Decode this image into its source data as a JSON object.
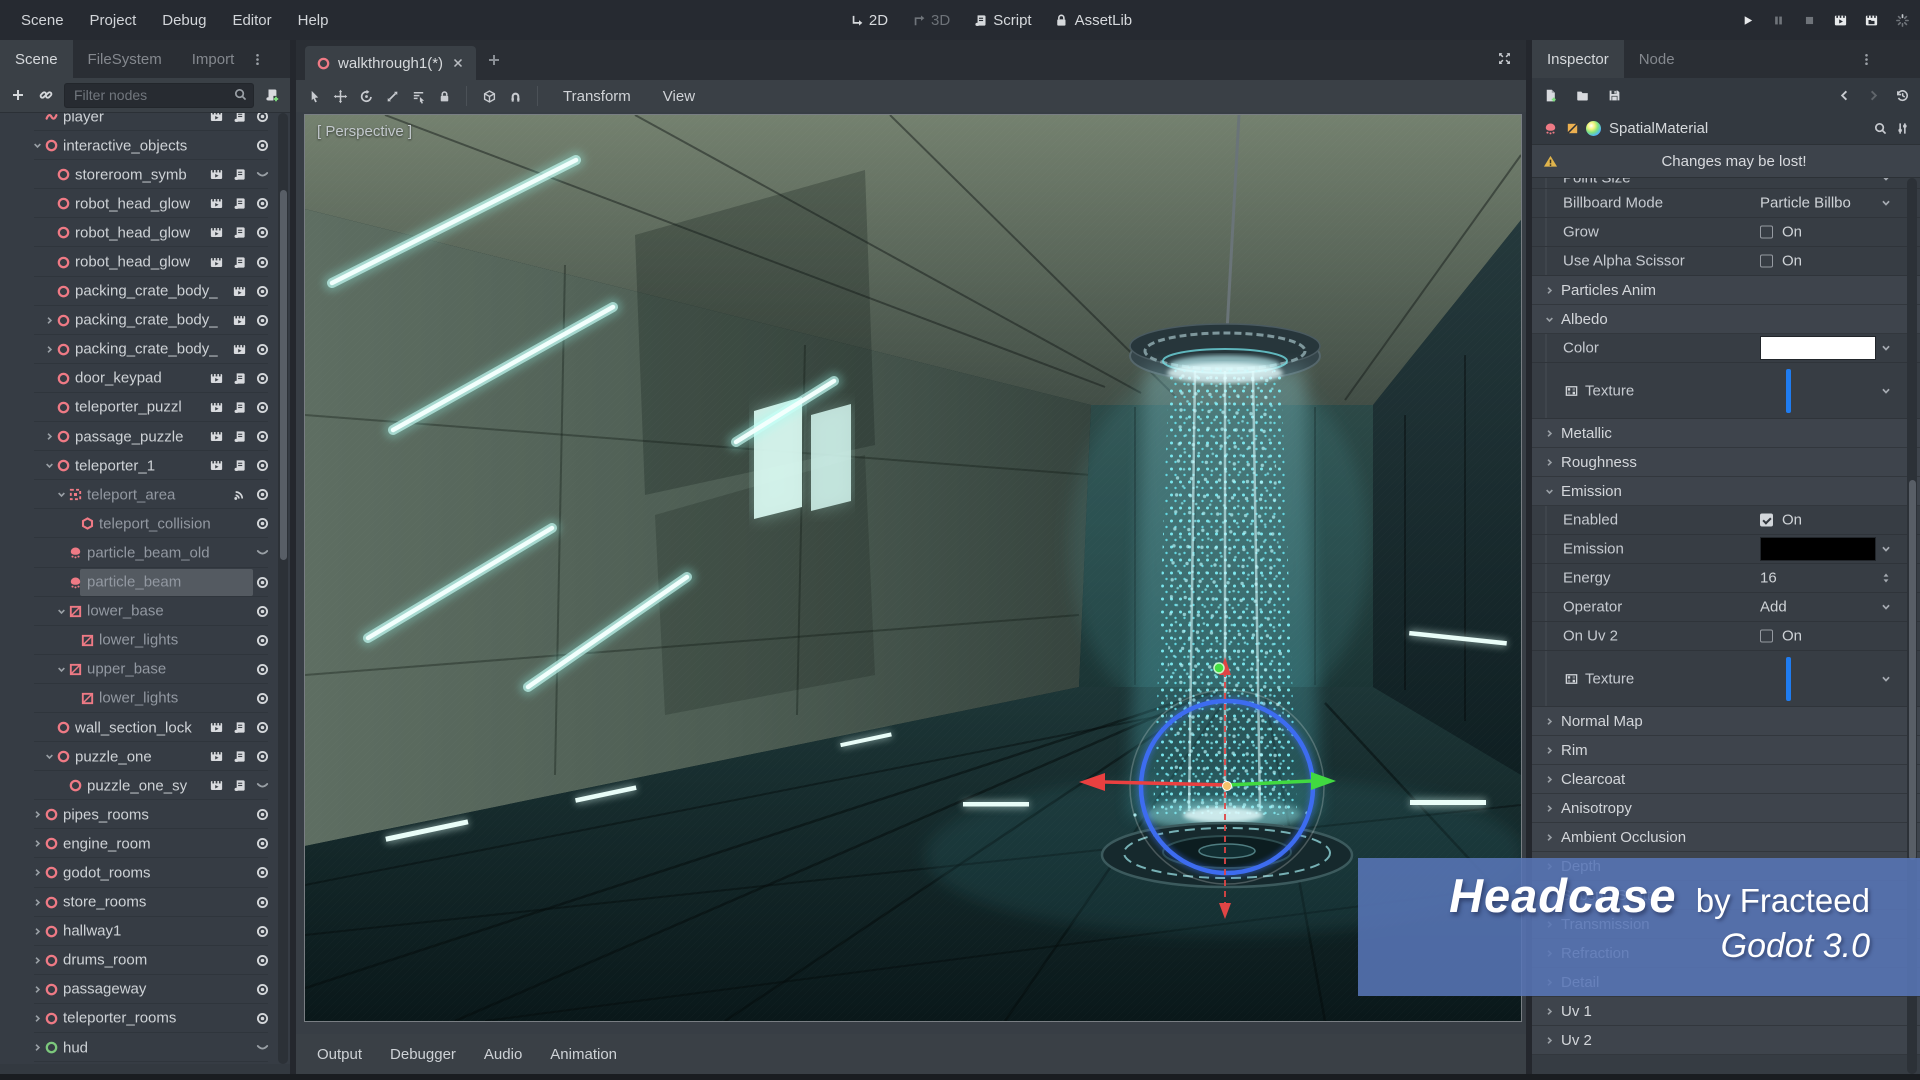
{
  "menubar": {
    "items": [
      "Scene",
      "Project",
      "Debug",
      "Editor",
      "Help"
    ],
    "center": [
      {
        "label": "2D",
        "icon": "nav2d",
        "bright": true
      },
      {
        "label": "3D",
        "icon": "nav3d",
        "bright": false
      },
      {
        "label": "Script",
        "icon": "scroll",
        "bright": true
      },
      {
        "label": "AssetLib",
        "icon": "assetlib",
        "bright": true
      }
    ],
    "playback": [
      {
        "icon": "play",
        "bright": true
      },
      {
        "icon": "pause",
        "bright": false
      },
      {
        "icon": "stop",
        "bright": false
      },
      {
        "icon": "play-scene",
        "bright": true
      },
      {
        "icon": "play-custom",
        "bright": true
      },
      {
        "icon": "spinner",
        "bright": false
      }
    ]
  },
  "left_dock": {
    "tabs": [
      {
        "label": "Scene",
        "active": true
      },
      {
        "label": "FileSystem",
        "active": false
      },
      {
        "label": "Import",
        "active": false
      }
    ],
    "filter_placeholder": "Filter nodes",
    "tree": [
      {
        "label": "player",
        "level": 1,
        "icon": "player",
        "arrow": "",
        "buttons": [
          "clapper",
          "script",
          "eye"
        ],
        "dim": false,
        "selected": false
      },
      {
        "label": "interactive_objects",
        "level": 1,
        "icon": "ring",
        "arrow": "down",
        "buttons": [
          "eye"
        ],
        "dim": false,
        "selected": false
      },
      {
        "label": "storeroom_symb",
        "level": 2,
        "icon": "ring",
        "arrow": "",
        "buttons": [
          "clapper",
          "script",
          "eye-closed"
        ],
        "dim": false,
        "selected": false
      },
      {
        "label": "robot_head_glow",
        "level": 2,
        "icon": "ring",
        "arrow": "",
        "buttons": [
          "clapper",
          "script",
          "eye"
        ],
        "dim": false,
        "selected": false
      },
      {
        "label": "robot_head_glow",
        "level": 2,
        "icon": "ring",
        "arrow": "",
        "buttons": [
          "clapper",
          "script",
          "eye"
        ],
        "dim": false,
        "selected": false
      },
      {
        "label": "robot_head_glow",
        "level": 2,
        "icon": "ring",
        "arrow": "",
        "buttons": [
          "clapper",
          "script",
          "eye"
        ],
        "dim": false,
        "selected": false
      },
      {
        "label": "packing_crate_body_",
        "level": 2,
        "icon": "ring",
        "arrow": "",
        "buttons": [
          "clapper",
          "eye"
        ],
        "dim": false,
        "selected": false
      },
      {
        "label": "packing_crate_body_",
        "level": 2,
        "icon": "ring",
        "arrow": "right",
        "buttons": [
          "clapper",
          "eye"
        ],
        "dim": false,
        "selected": false
      },
      {
        "label": "packing_crate_body_",
        "level": 2,
        "icon": "ring",
        "arrow": "right",
        "buttons": [
          "clapper",
          "eye"
        ],
        "dim": false,
        "selected": false
      },
      {
        "label": "door_keypad",
        "level": 2,
        "icon": "ring",
        "arrow": "",
        "buttons": [
          "clapper",
          "script",
          "eye"
        ],
        "dim": false,
        "selected": false
      },
      {
        "label": "teleporter_puzzl",
        "level": 2,
        "icon": "ring",
        "arrow": "",
        "buttons": [
          "clapper",
          "script",
          "eye"
        ],
        "dim": false,
        "selected": false
      },
      {
        "label": "passage_puzzle",
        "level": 2,
        "icon": "ring",
        "arrow": "right",
        "buttons": [
          "clapper",
          "script",
          "eye"
        ],
        "dim": false,
        "selected": false
      },
      {
        "label": "teleporter_1",
        "level": 2,
        "icon": "ring",
        "arrow": "down",
        "buttons": [
          "clapper",
          "script",
          "eye"
        ],
        "dim": false,
        "selected": false
      },
      {
        "label": "teleport_area",
        "level": 3,
        "icon": "area",
        "arrow": "down",
        "buttons": [
          "signal",
          "eye"
        ],
        "dim": true,
        "selected": false
      },
      {
        "label": "teleport_collision",
        "level": 4,
        "icon": "collision",
        "arrow": "",
        "buttons": [
          "eye"
        ],
        "dim": true,
        "selected": false
      },
      {
        "label": "particle_beam_old",
        "level": 3,
        "icon": "particles",
        "arrow": "",
        "buttons": [
          "eye-closed"
        ],
        "dim": true,
        "selected": false
      },
      {
        "label": "particle_beam",
        "level": 3,
        "icon": "particles",
        "arrow": "",
        "buttons": [
          "eye"
        ],
        "dim": true,
        "selected": true
      },
      {
        "label": "lower_base",
        "level": 3,
        "icon": "mesh",
        "arrow": "down",
        "buttons": [
          "eye"
        ],
        "dim": true,
        "selected": false
      },
      {
        "label": "lower_lights",
        "level": 4,
        "icon": "mesh",
        "arrow": "",
        "buttons": [
          "eye"
        ],
        "dim": true,
        "selected": false
      },
      {
        "label": "upper_base",
        "level": 3,
        "icon": "mesh",
        "arrow": "down",
        "buttons": [
          "eye"
        ],
        "dim": true,
        "selected": false
      },
      {
        "label": "lower_lights",
        "level": 4,
        "icon": "mesh",
        "arrow": "",
        "buttons": [
          "eye"
        ],
        "dim": true,
        "selected": false
      },
      {
        "label": "wall_section_lock",
        "level": 2,
        "icon": "ring",
        "arrow": "",
        "buttons": [
          "clapper",
          "script",
          "eye"
        ],
        "dim": false,
        "selected": false
      },
      {
        "label": "puzzle_one",
        "level": 2,
        "icon": "ring",
        "arrow": "down",
        "buttons": [
          "clapper",
          "script",
          "eye"
        ],
        "dim": false,
        "selected": false
      },
      {
        "label": "puzzle_one_sy",
        "level": 3,
        "icon": "ring",
        "arrow": "",
        "buttons": [
          "clapper",
          "script",
          "eye-closed"
        ],
        "dim": false,
        "selected": false
      },
      {
        "label": "pipes_rooms",
        "level": 1,
        "icon": "ring",
        "arrow": "right",
        "buttons": [
          "eye"
        ],
        "dim": false,
        "selected": false
      },
      {
        "label": "engine_room",
        "level": 1,
        "icon": "ring",
        "arrow": "right",
        "buttons": [
          "eye"
        ],
        "dim": false,
        "selected": false
      },
      {
        "label": "godot_rooms",
        "level": 1,
        "icon": "ring",
        "arrow": "right",
        "buttons": [
          "eye"
        ],
        "dim": false,
        "selected": false
      },
      {
        "label": "store_rooms",
        "level": 1,
        "icon": "ring",
        "arrow": "right",
        "buttons": [
          "eye"
        ],
        "dim": false,
        "selected": false
      },
      {
        "label": "hallway1",
        "level": 1,
        "icon": "ring",
        "arrow": "right",
        "buttons": [
          "eye"
        ],
        "dim": false,
        "selected": false
      },
      {
        "label": "drums_room",
        "level": 1,
        "icon": "ring",
        "arrow": "right",
        "buttons": [
          "eye"
        ],
        "dim": false,
        "selected": false
      },
      {
        "label": "passageway",
        "level": 1,
        "icon": "ring",
        "arrow": "right",
        "buttons": [
          "eye"
        ],
        "dim": false,
        "selected": false
      },
      {
        "label": "teleporter_rooms",
        "level": 1,
        "icon": "ring",
        "arrow": "right",
        "buttons": [
          "eye"
        ],
        "dim": false,
        "selected": false
      },
      {
        "label": "hud",
        "level": 1,
        "icon": "ring-green",
        "arrow": "right",
        "buttons": [
          "eye-closed"
        ],
        "dim": false,
        "selected": false
      }
    ]
  },
  "scene_tabs": {
    "tabs": [
      {
        "label": "walkthrough1(*)"
      }
    ],
    "viewport_menus": [
      "Transform",
      "View"
    ]
  },
  "viewport": {
    "perspective_label": "[ Perspective ]"
  },
  "bottom_bar": {
    "tabs": [
      "Output",
      "Debugger",
      "Audio",
      "Animation"
    ]
  },
  "inspector": {
    "tabs": [
      {
        "label": "Inspector",
        "active": true
      },
      {
        "label": "Node",
        "active": false
      }
    ],
    "object_name": "SpatialMaterial",
    "warning": "Changes may be lost!",
    "rows": [
      {
        "kind": "prop",
        "label": "Point Size",
        "control": "clipped"
      },
      {
        "kind": "prop",
        "label": "Billboard Mode",
        "control": "dropdown",
        "value": "Particle Billbo"
      },
      {
        "kind": "prop",
        "label": "Grow",
        "control": "check",
        "checked": false,
        "value": "On"
      },
      {
        "kind": "prop",
        "label": "Use Alpha Scissor",
        "control": "check",
        "checked": false,
        "value": "On"
      },
      {
        "kind": "section",
        "label": "Particles Anim",
        "expanded": false
      },
      {
        "kind": "section",
        "label": "Albedo",
        "expanded": true
      },
      {
        "kind": "prop",
        "label": "Color",
        "control": "swatch",
        "swatch": "#ffffff"
      },
      {
        "kind": "prop",
        "label": "Texture",
        "control": "texture"
      },
      {
        "kind": "section",
        "label": "Metallic",
        "expanded": false
      },
      {
        "kind": "section",
        "label": "Roughness",
        "expanded": false
      },
      {
        "kind": "section",
        "label": "Emission",
        "expanded": true
      },
      {
        "kind": "prop",
        "label": "Enabled",
        "control": "check",
        "checked": true,
        "value": "On"
      },
      {
        "kind": "prop",
        "label": "Emission",
        "control": "swatch",
        "swatch": "#000000"
      },
      {
        "kind": "prop",
        "label": "Energy",
        "control": "number",
        "value": "16"
      },
      {
        "kind": "prop",
        "label": "Operator",
        "control": "dropdown",
        "value": "Add"
      },
      {
        "kind": "prop",
        "label": "On Uv 2",
        "control": "check",
        "checked": false,
        "value": "On"
      },
      {
        "kind": "prop",
        "label": "Texture",
        "control": "texture"
      },
      {
        "kind": "section",
        "label": "Normal Map",
        "expanded": false
      },
      {
        "kind": "section",
        "label": "Rim",
        "expanded": false
      },
      {
        "kind": "section",
        "label": "Clearcoat",
        "expanded": false
      },
      {
        "kind": "section",
        "label": "Anisotropy",
        "expanded": false
      },
      {
        "kind": "section",
        "label": "Ambient Occlusion",
        "expanded": false
      },
      {
        "kind": "section",
        "label": "Depth",
        "expanded": false
      },
      {
        "kind": "section",
        "label": "Subsurf Scatter",
        "expanded": false
      },
      {
        "kind": "section",
        "label": "Transmission",
        "expanded": false
      },
      {
        "kind": "section",
        "label": "Refraction",
        "expanded": false
      },
      {
        "kind": "section",
        "label": "Detail",
        "expanded": false
      },
      {
        "kind": "section",
        "label": "Uv 1",
        "expanded": false
      },
      {
        "kind": "section",
        "label": "Uv 2",
        "expanded": false
      }
    ]
  },
  "watermark": {
    "title": "Headcase",
    "byline": "by Fracteed",
    "version": "Godot 3.0"
  },
  "colors": {
    "texture_thumb": "#1f7cf0",
    "node_pink": "#ef7a85",
    "node_green": "#7cc87c",
    "selection": "#545a61",
    "warning_yellow": "#e0b44c",
    "watermark_blue": "rgba(88,117,182,0.88)",
    "albedo_color": "#ffffff",
    "emission_color": "#000000"
  }
}
